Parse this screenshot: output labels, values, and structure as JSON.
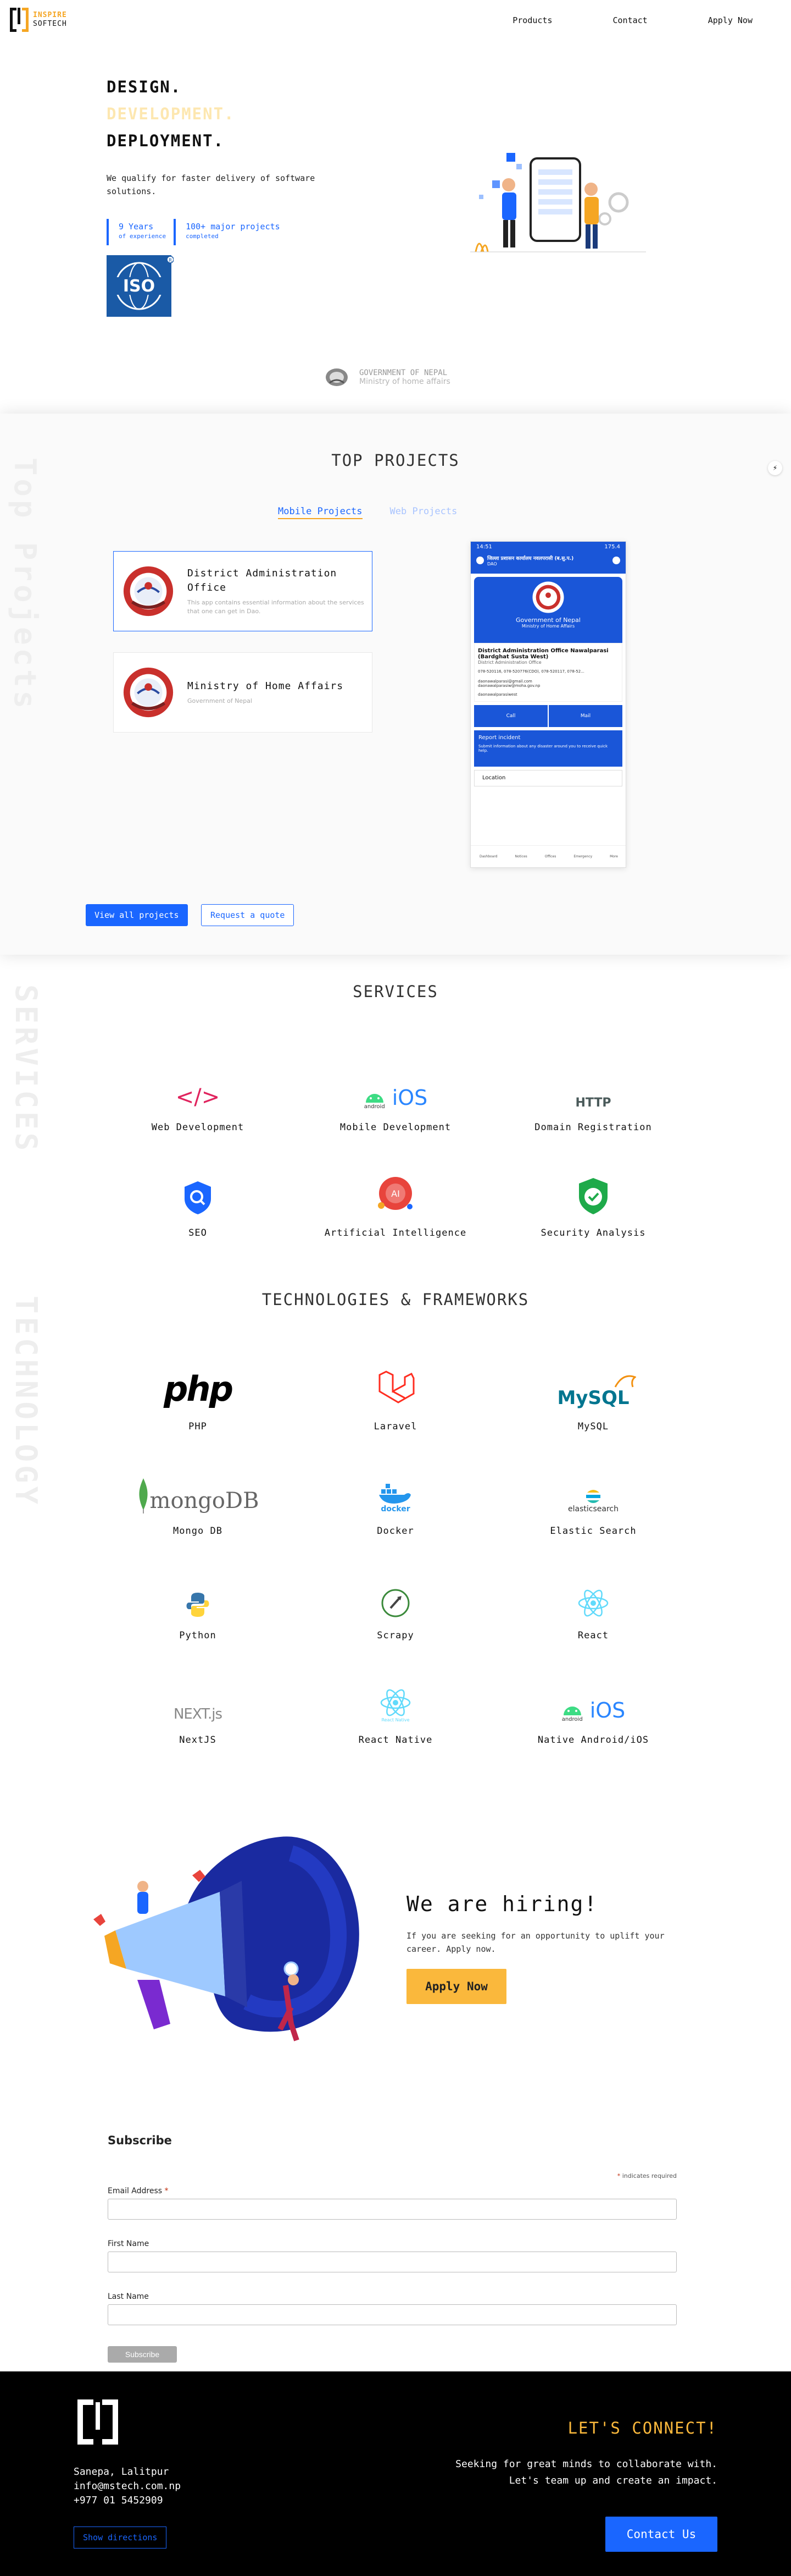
{
  "header": {
    "logo_line1": "INSPIRE",
    "logo_line2": "SOFTECH",
    "nav": [
      "Products",
      "Contact",
      "Apply Now"
    ]
  },
  "hero": {
    "lines": [
      "DESIGN.",
      "DEVELOPMENT.",
      "DEPLOYMENT."
    ],
    "description": "We qualify for faster delivery of software solutions.",
    "stats": [
      {
        "value": "9 Years",
        "sub": "of experience"
      },
      {
        "value": "100+ major projects",
        "sub": "completed"
      }
    ],
    "iso": "ISO",
    "gov_title": "GOVERNMENT OF NEPAL",
    "gov_sub": "Ministry of home affairs"
  },
  "projects": {
    "side_word": "Top Projects",
    "title": "TOP PROJECTS",
    "tabs": [
      "Mobile Projects",
      "Web Projects"
    ],
    "items": [
      {
        "title": "District Administration Office",
        "desc": "This app contains essential information about the services that one can get in Dao."
      },
      {
        "title": "Ministry of Home Affairs",
        "desc": "Government of Nepal"
      }
    ],
    "phone": {
      "status_time": "14:51",
      "status_right": "175.4",
      "topbar": "जिल्ला प्रशासन कार्यालय नवलपरासी (ब.सु.प.)",
      "topbar_sub": "DAO",
      "gov": "Government of Nepal",
      "ministry": "Ministry of Home Affairs",
      "office": "District Administration Office Nawalparasi (Bardghat Susta West)",
      "office_sub": "District Administration Office",
      "phone_line": "078-520116, 078-520776(CDO), 078-520117, 078-52...",
      "email_line1": "daonawalparasi@gmail.com",
      "email_line2": "daonawalparasiw@moha.gov.np",
      "web_line": "daonawalparasiwest",
      "call": "Call",
      "mail": "Mail",
      "report": "Report incident",
      "report_sub": "Submit information about any disaster around you to receive quick help.",
      "location": "Location",
      "nav_items": [
        "Dashboard",
        "Notices",
        "Offices",
        "Emergency",
        "More"
      ]
    },
    "btn_view": "View all projects",
    "btn_quote": "Request a quote"
  },
  "services": {
    "side_word": "SERVICES",
    "title": "SERVICES",
    "items": [
      {
        "label": "Web Development",
        "icon": "code-icon"
      },
      {
        "label": "Mobile Development",
        "icon": "android-ios-icon"
      },
      {
        "label": "Domain Registration",
        "icon": "http-icon"
      },
      {
        "label": "SEO",
        "icon": "seo-search-icon"
      },
      {
        "label": "Artificial Intelligence",
        "icon": "ai-brain-icon"
      },
      {
        "label": "Security Analysis",
        "icon": "security-shield-icon"
      }
    ],
    "http_text": "HTTP",
    "code_text": "</>",
    "ios_text": "iOS",
    "android_text": "android",
    "ai_text": "AI"
  },
  "tech": {
    "side_word": "TECHNOLOGY",
    "title": "TECHNOLOGIES & FRAMEWORKS",
    "items": [
      {
        "label": "PHP",
        "icon": "php-logo"
      },
      {
        "label": "Laravel",
        "icon": "laravel-logo"
      },
      {
        "label": "MySQL",
        "icon": "mysql-logo"
      },
      {
        "label": "Mongo DB",
        "icon": "mongodb-logo"
      },
      {
        "label": "Docker",
        "icon": "docker-logo"
      },
      {
        "label": "Elastic Search",
        "icon": "elasticsearch-logo"
      },
      {
        "label": "Python",
        "icon": "python-logo"
      },
      {
        "label": "Scrapy",
        "icon": "scrapy-logo"
      },
      {
        "label": "React",
        "icon": "react-logo"
      },
      {
        "label": "NextJS",
        "icon": "nextjs-logo"
      },
      {
        "label": "React Native",
        "icon": "react-native-logo"
      },
      {
        "label": "Native Android/iOS",
        "icon": "android-ios-icon"
      }
    ],
    "php_text": "php",
    "mysql_text": "MySQL",
    "mongo_text": "mongoDB",
    "docker_text": "docker",
    "elastic_text": "elasticsearch",
    "next_text": "NEXT.js",
    "rn_text": "React Native",
    "ios_text": "iOS",
    "android_text": "android"
  },
  "hiring": {
    "title": "We are hiring!",
    "desc": "If you are seeking for an opportunity to uplift your career. Apply now.",
    "button": "Apply Now"
  },
  "subscribe": {
    "title": "Subscribe",
    "required_note": "indicates required",
    "email_label": "Email Address",
    "first_label": "First Name",
    "last_label": "Last Name",
    "button": "Subscribe"
  },
  "footer": {
    "address": "Sanepa, Lalitpur",
    "email": "info@mstech.com.np",
    "phone": "+977 01 5452909",
    "directions": "Show directions",
    "connect": "LET'S CONNECT!",
    "text_line1": "Seeking for great minds to collaborate with.",
    "text_line2": "Let's team up and create an impact.",
    "contact": "Contact Us"
  },
  "colors": {
    "accent_blue": "#1a66ff",
    "accent_yellow": "#fab83c",
    "footer_bg": "#000000"
  }
}
